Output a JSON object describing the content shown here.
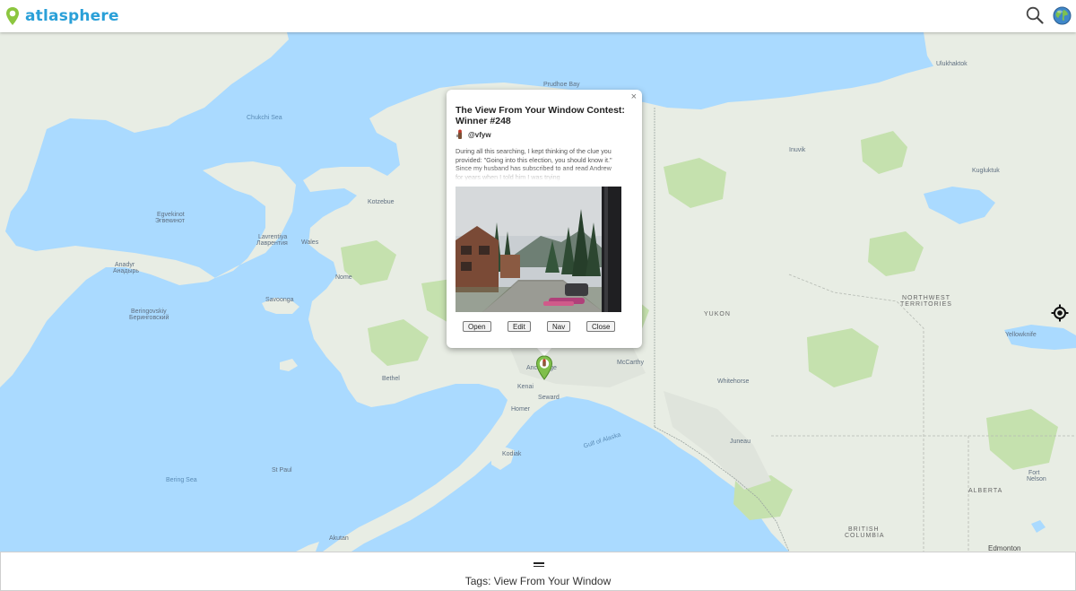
{
  "app": {
    "name": "atlasphere"
  },
  "header": {
    "search_icon": "search-icon",
    "globe_icon": "globe-icon"
  },
  "map": {
    "labels": {
      "chukchi_sea": "Chukchi Sea",
      "bering_sea": "Bering Sea",
      "gulf_of_alaska": "Gulf of Alaska",
      "yukon": "YUKON",
      "nwt_1": "NORTHWEST",
      "nwt_2": "TERRITORIES",
      "alberta": "ALBERTA",
      "bc_1": "BRITISH",
      "bc_2": "COLUMBIA",
      "anchorage": "Anchorage",
      "kotzebue": "Kotzebue",
      "nome": "Nome",
      "wales": "Wales",
      "savoonga": "Savoonga",
      "bethel": "Bethel",
      "kenai": "Kenai",
      "seward": "Seward",
      "homer": "Homer",
      "kodiak": "Kodiak",
      "st_paul": "St Paul",
      "akutan": "Akutan",
      "mccarthy": "McCarthy",
      "whitehorse": "Whitehorse",
      "juneau": "Juneau",
      "yellowknife": "Yellowknife",
      "fort_nelson_1": "Fort",
      "fort_nelson_2": "Nelson",
      "edmonton": "Edmonton",
      "prudhoe_bay": "Prudhoe Bay",
      "inuvik": "Inuvik",
      "kugluktuk": "Kugluktuk",
      "ulukhaktok": "Ulukhaktok",
      "lavrentiya_1": "Lavrentiya",
      "lavrentiya_2": "Лаврентия",
      "anadyr_1": "Anadyr",
      "anadyr_2": "Анадырь",
      "egvekinot_1": "Egvekinot",
      "egvekinot_2": "Эгвекинот",
      "beringovskiy_1": "Beringovskiy",
      "beringovskiy_2": "Беринговский"
    }
  },
  "popup": {
    "title": "The View From Your Window Contest: Winner #248",
    "author": "@vfyw",
    "excerpt": "During all this searching, I kept thinking of the clue you provided: \"Going into this election, you should know it.\" Since my husband has subscribed to and read Andrew for years when I told him I was trying",
    "buttons": {
      "open": "Open",
      "edit": "Edit",
      "nav": "Nav",
      "close": "Close"
    },
    "close_glyph": "×"
  },
  "footer": {
    "tags": "Tags: View From Your Window"
  },
  "colors": {
    "brand": "#2aa0d8",
    "logo_pin": "#8cc63f",
    "water": "#aadaff",
    "land": "#e8ede4",
    "forest": "#c5e1ae"
  }
}
